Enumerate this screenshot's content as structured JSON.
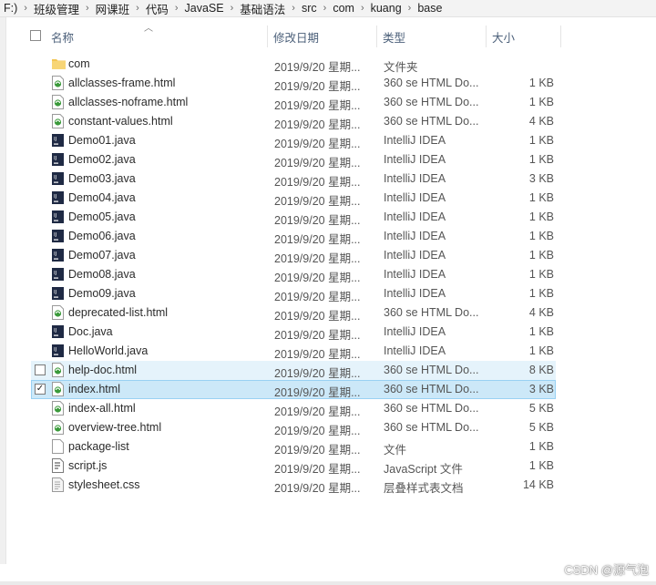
{
  "breadcrumb": [
    "F:)",
    "班级管理",
    "网课班",
    "代码",
    "JavaSE",
    "基础语法",
    "src",
    "com",
    "kuang",
    "base"
  ],
  "columns": {
    "name": "名称",
    "date": "修改日期",
    "type": "类型",
    "size": "大小"
  },
  "files": [
    {
      "name": "com",
      "date": "2019/9/20 星期...",
      "type": "文件夹",
      "size": "",
      "icon": "folder-icon"
    },
    {
      "name": "allclasses-frame.html",
      "date": "2019/9/20 星期...",
      "type": "360 se HTML Do...",
      "size": "1 KB",
      "icon": "html-file-icon"
    },
    {
      "name": "allclasses-noframe.html",
      "date": "2019/9/20 星期...",
      "type": "360 se HTML Do...",
      "size": "1 KB",
      "icon": "html-file-icon"
    },
    {
      "name": "constant-values.html",
      "date": "2019/9/20 星期...",
      "type": "360 se HTML Do...",
      "size": "4 KB",
      "icon": "html-file-icon"
    },
    {
      "name": "Demo01.java",
      "date": "2019/9/20 星期...",
      "type": "IntelliJ IDEA",
      "size": "1 KB",
      "icon": "java-file-icon"
    },
    {
      "name": "Demo02.java",
      "date": "2019/9/20 星期...",
      "type": "IntelliJ IDEA",
      "size": "1 KB",
      "icon": "java-file-icon"
    },
    {
      "name": "Demo03.java",
      "date": "2019/9/20 星期...",
      "type": "IntelliJ IDEA",
      "size": "3 KB",
      "icon": "java-file-icon"
    },
    {
      "name": "Demo04.java",
      "date": "2019/9/20 星期...",
      "type": "IntelliJ IDEA",
      "size": "1 KB",
      "icon": "java-file-icon"
    },
    {
      "name": "Demo05.java",
      "date": "2019/9/20 星期...",
      "type": "IntelliJ IDEA",
      "size": "1 KB",
      "icon": "java-file-icon"
    },
    {
      "name": "Demo06.java",
      "date": "2019/9/20 星期...",
      "type": "IntelliJ IDEA",
      "size": "1 KB",
      "icon": "java-file-icon"
    },
    {
      "name": "Demo07.java",
      "date": "2019/9/20 星期...",
      "type": "IntelliJ IDEA",
      "size": "1 KB",
      "icon": "java-file-icon"
    },
    {
      "name": "Demo08.java",
      "date": "2019/9/20 星期...",
      "type": "IntelliJ IDEA",
      "size": "1 KB",
      "icon": "java-file-icon"
    },
    {
      "name": "Demo09.java",
      "date": "2019/9/20 星期...",
      "type": "IntelliJ IDEA",
      "size": "1 KB",
      "icon": "java-file-icon"
    },
    {
      "name": "deprecated-list.html",
      "date": "2019/9/20 星期...",
      "type": "360 se HTML Do...",
      "size": "4 KB",
      "icon": "html-file-icon"
    },
    {
      "name": "Doc.java",
      "date": "2019/9/20 星期...",
      "type": "IntelliJ IDEA",
      "size": "1 KB",
      "icon": "java-file-icon"
    },
    {
      "name": "HelloWorld.java",
      "date": "2019/9/20 星期...",
      "type": "IntelliJ IDEA",
      "size": "1 KB",
      "icon": "java-file-icon"
    },
    {
      "name": "help-doc.html",
      "date": "2019/9/20 星期...",
      "type": "360 se HTML Do...",
      "size": "8 KB",
      "icon": "html-file-icon",
      "state": "hover"
    },
    {
      "name": "index.html",
      "date": "2019/9/20 星期...",
      "type": "360 se HTML Do...",
      "size": "3 KB",
      "icon": "html-file-icon",
      "state": "selected"
    },
    {
      "name": "index-all.html",
      "date": "2019/9/20 星期...",
      "type": "360 se HTML Do...",
      "size": "5 KB",
      "icon": "html-file-icon"
    },
    {
      "name": "overview-tree.html",
      "date": "2019/9/20 星期...",
      "type": "360 se HTML Do...",
      "size": "5 KB",
      "icon": "html-file-icon"
    },
    {
      "name": "package-list",
      "date": "2019/9/20 星期...",
      "type": "文件",
      "size": "1 KB",
      "icon": "blank-file-icon"
    },
    {
      "name": "script.js",
      "date": "2019/9/20 星期...",
      "type": "JavaScript 文件",
      "size": "1 KB",
      "icon": "script-file-icon"
    },
    {
      "name": "stylesheet.css",
      "date": "2019/9/20 星期...",
      "type": "层叠样式表文档",
      "size": "14 KB",
      "icon": "css-file-icon"
    }
  ],
  "watermark": "CSDN @源气泡",
  "colors": {
    "hover": "#e5f3fb",
    "selected": "#cce8f8",
    "header_text": "#4c607a",
    "folder": "#f3c654",
    "html_icon": "#3a9a3a",
    "java_icon": "#1f2a44"
  }
}
